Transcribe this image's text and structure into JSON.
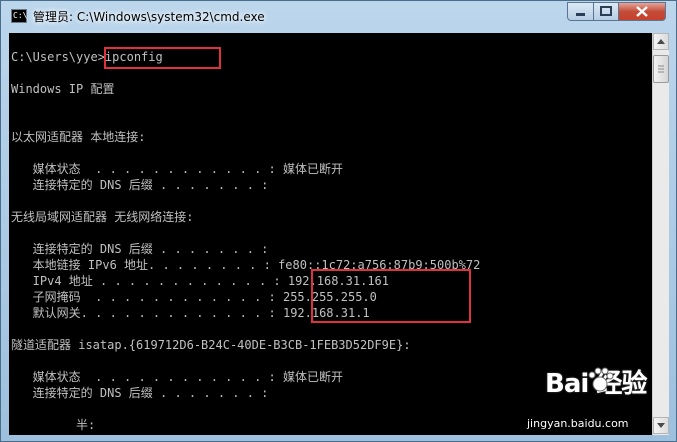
{
  "window": {
    "title": "管理员: C:\\Windows\\system32\\cmd.exe",
    "icon_text": "C:\\"
  },
  "console": {
    "lines": [
      "C:\\Users\\yye>ipconfig",
      "Windows IP 配置",
      "以太网适配器 本地连接:",
      "   媒体状态  . . . . . . . . . . . . : 媒体已断开",
      "   连接特定的 DNS 后缀 . . . . . . . :",
      "无线局域网适配器 无线网络连接:",
      "   连接特定的 DNS 后缀 . . . . . . . :",
      "   本地链接 IPv6 地址. . . . . . . . : fe80::1c72:a756:87b9:500b%72",
      "   IPv4 地址 . . . . . . . . . . . . : 192.168.31.161",
      "   子网掩码  . . . . . . . . . . . . : 255.255.255.0",
      "   默认网关. . . . . . . . . . . . . : 192.168.31.1",
      "隧道适配器 isatap.{619712D6-B24C-40DE-B3CB-1FEB3D52DF9E}:",
      "   媒体状态  . . . . . . . . . . . . : 媒体已断开",
      "   连接特定的 DNS 后缀 . . . . . . . :",
      "         半:"
    ]
  },
  "watermark": {
    "logo": "Bai 经验",
    "url": "jingyan.baidu.com"
  },
  "colors": {
    "highlight": "#e0323c",
    "console_bg": "#000000",
    "console_text": "#c0c0c0"
  }
}
